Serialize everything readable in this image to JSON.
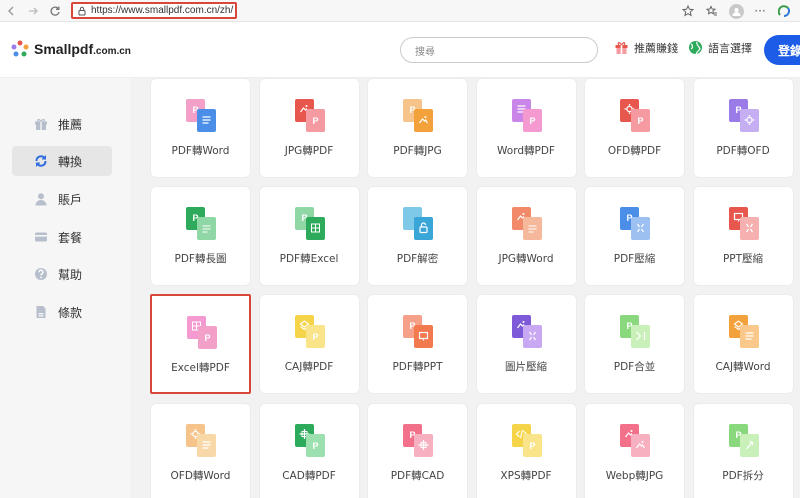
{
  "browser": {
    "url": "https://www.smallpdf.com.cn/zh/",
    "menu_dots": "···"
  },
  "header": {
    "logo_main": "Smallpdf",
    "logo_tld": ".com.cn",
    "search_placeholder": "搜尋",
    "referral": "推薦賺錢",
    "language": "語言選擇",
    "login": "登錄"
  },
  "sidebar": {
    "items": [
      {
        "label": "推薦"
      },
      {
        "label": "轉換"
      },
      {
        "label": "賬戶"
      },
      {
        "label": "套餐"
      },
      {
        "label": "幫助"
      },
      {
        "label": "條款"
      }
    ]
  },
  "tools": [
    {
      "label": "PDF轉Word",
      "back": "#f2a0c8",
      "front": "#4a8ee8",
      "glyph": "W",
      "back_glyph": "P"
    },
    {
      "label": "JPG轉PDF",
      "back": "#e8574e",
      "front": "#f49aa0",
      "glyph": "P",
      "back_glyph": "img"
    },
    {
      "label": "PDF轉JPG",
      "back": "#f6c48a",
      "front": "#f3a23b",
      "glyph": "img",
      "back_glyph": "P"
    },
    {
      "label": "Word轉PDF",
      "back": "#c986e8",
      "front": "#f49ad0",
      "glyph": "P",
      "back_glyph": "W"
    },
    {
      "label": "OFD轉PDF",
      "back": "#e8574e",
      "front": "#f49aa0",
      "glyph": "P",
      "back_glyph": "gear"
    },
    {
      "label": "PDF轉OFD",
      "back": "#9b7be8",
      "front": "#c5aef2",
      "glyph": "gear",
      "back_glyph": "P"
    },
    {
      "label": "PDF轉長圖",
      "back": "#2eaa5c",
      "front": "#8fd8a6",
      "glyph": "line",
      "back_glyph": "P"
    },
    {
      "label": "PDF轉Excel",
      "back": "#8fd8a6",
      "front": "#2eaa5c",
      "glyph": "grid",
      "back_glyph": "P"
    },
    {
      "label": "PDF解密",
      "back": "#7ec8e8",
      "front": "#3aa6d8",
      "glyph": "lock",
      "back_glyph": ""
    },
    {
      "label": "JPG轉Word",
      "back": "#f28a6a",
      "front": "#f6b89a",
      "glyph": "line",
      "back_glyph": "img"
    },
    {
      "label": "PDF壓縮",
      "back": "#4a8ee8",
      "front": "#9cc0f2",
      "glyph": "compress",
      "back_glyph": "P"
    },
    {
      "label": "PPT壓縮",
      "back": "#e8574e",
      "front": "#f6b0b0",
      "glyph": "compress",
      "back_glyph": "ppt"
    },
    {
      "label": "Excel轉PDF",
      "back": "#f49ad0",
      "front": "#f2a0c8",
      "glyph": "P",
      "back_glyph": "grid"
    },
    {
      "label": "CAJ轉PDF",
      "back": "#f6d44a",
      "front": "#f9e48a",
      "glyph": "P",
      "back_glyph": "layers"
    },
    {
      "label": "PDF轉PPT",
      "back": "#f6a08a",
      "front": "#f27a4e",
      "glyph": "ppt",
      "back_glyph": "P"
    },
    {
      "label": "圖片壓縮",
      "back": "#7e5ad8",
      "front": "#c8a8f2",
      "glyph": "compress",
      "back_glyph": "img"
    },
    {
      "label": "PDF合並",
      "back": "#8ad87e",
      "front": "#c8f0b8",
      "glyph": "merge",
      "back_glyph": "P"
    },
    {
      "label": "CAJ轉Word",
      "back": "#f3a23b",
      "front": "#f9c88a",
      "glyph": "W",
      "back_glyph": "layers"
    },
    {
      "label": "OFD轉Word",
      "back": "#f6c48a",
      "front": "#f9d8a8",
      "glyph": "W",
      "back_glyph": "gear"
    },
    {
      "label": "CAD轉PDF",
      "back": "#2eaa5c",
      "front": "#9ce0b0",
      "glyph": "P",
      "back_glyph": "cross"
    },
    {
      "label": "PDF轉CAD",
      "back": "#f2708a",
      "front": "#f6b0c0",
      "glyph": "cross",
      "back_glyph": "P"
    },
    {
      "label": "XPS轉PDF",
      "back": "#f6d44a",
      "front": "#f9e48a",
      "glyph": "P",
      "back_glyph": "code"
    },
    {
      "label": "Webp轉JPG",
      "back": "#f2708a",
      "front": "#f6b0c0",
      "glyph": "img",
      "back_glyph": "img"
    },
    {
      "label": "PDF拆分",
      "back": "#8ad87e",
      "front": "#c8f0b8",
      "glyph": "split",
      "back_glyph": "P"
    }
  ]
}
